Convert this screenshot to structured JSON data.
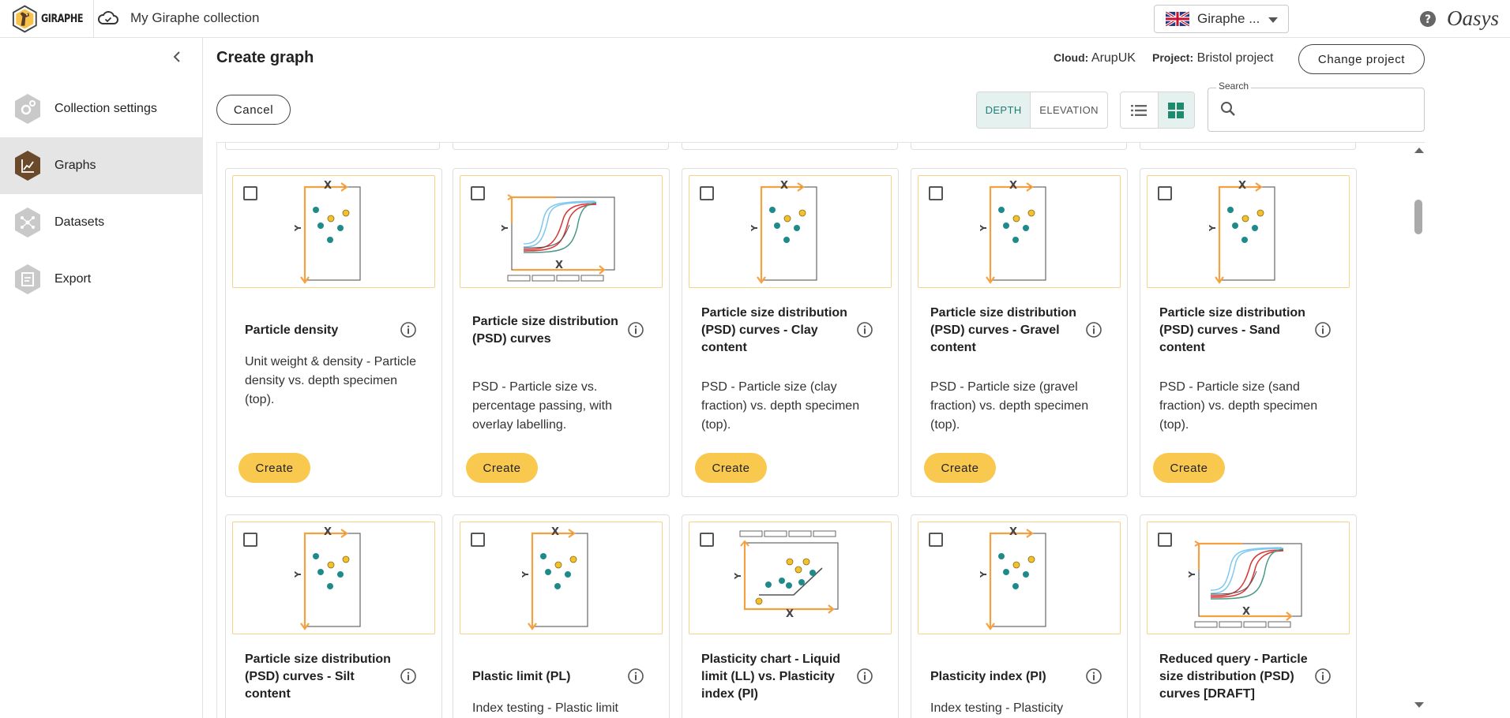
{
  "app": {
    "logo_text": "GIRAPHE",
    "collection_title": "My Giraphe collection",
    "language": {
      "selected": "Giraphe ...",
      "flag": "uk-flag"
    },
    "brand": "Oasys"
  },
  "sidebar": {
    "items": [
      {
        "label": "Collection settings",
        "icon": "settings-gear-icon",
        "active": false
      },
      {
        "label": "Graphs",
        "icon": "graph-icon",
        "active": true
      },
      {
        "label": "Datasets",
        "icon": "datasets-network-icon",
        "active": false
      },
      {
        "label": "Export",
        "icon": "export-icon",
        "active": false
      }
    ]
  },
  "header": {
    "title": "Create graph",
    "cloud_label": "Cloud:",
    "cloud_value": "ArupUK",
    "project_label": "Project:",
    "project_value": "Bristol project",
    "change_project": "Change project",
    "cancel": "Cancel",
    "toggle": {
      "depth": "DEPTH",
      "elevation": "ELEVATION",
      "selected": "DEPTH"
    },
    "view_mode": "grid",
    "search": {
      "label": "Search",
      "value": "",
      "placeholder": ""
    }
  },
  "cards": [
    {
      "title": "Particle density",
      "desc": "Unit weight & density - Particle density vs. depth specimen (top).",
      "button": "Create",
      "thumb": "scatter-depth"
    },
    {
      "title": "Particle size distribution (PSD) curves",
      "desc": "PSD - Particle size vs. percentage passing, with overlay labelling.",
      "button": "Create",
      "thumb": "psd-curves"
    },
    {
      "title": "Particle size distribution (PSD) curves - Clay content",
      "desc": "PSD - Particle size (clay fraction) vs. depth specimen (top).",
      "button": "Create",
      "thumb": "scatter-depth"
    },
    {
      "title": "Particle size distribution (PSD) curves - Gravel content",
      "desc": "PSD - Particle size (gravel fraction) vs. depth specimen (top).",
      "button": "Create",
      "thumb": "scatter-depth"
    },
    {
      "title": "Particle size distribution (PSD) curves - Sand content",
      "desc": "PSD - Particle size (sand fraction) vs. depth specimen (top).",
      "button": "Create",
      "thumb": "scatter-depth"
    },
    {
      "title": "Particle size distribution (PSD) curves - Silt content",
      "desc": "",
      "button": "",
      "thumb": "scatter-depth"
    },
    {
      "title": "Plastic limit (PL)",
      "desc": "Index testing - Plastic limit",
      "button": "",
      "thumb": "scatter-depth"
    },
    {
      "title": "Plasticity chart - Liquid limit (LL) vs. Plasticity index (PI)",
      "desc": "",
      "button": "",
      "thumb": "plasticity-chart"
    },
    {
      "title": "Plasticity index (PI)",
      "desc": "Index testing - Plasticity",
      "button": "",
      "thumb": "scatter-depth"
    },
    {
      "title": "Reduced query - Particle size distribution (PSD) curves [DRAFT]",
      "desc": "",
      "button": "",
      "thumb": "psd-curves"
    }
  ],
  "colors": {
    "accent_orange": "#f5a142",
    "teal": "#1e8a8a",
    "yellow_dot": "#f2c12e",
    "create_button": "#f9c94f",
    "brand_dark": "#6b4a2b"
  }
}
